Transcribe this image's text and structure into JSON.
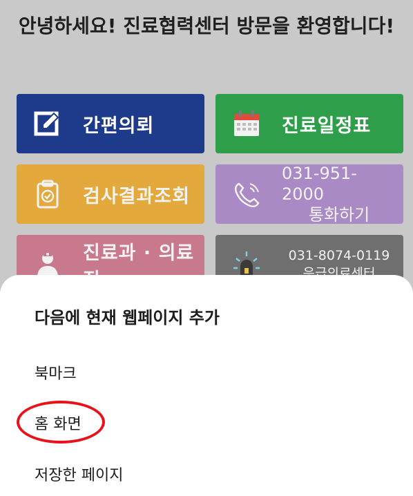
{
  "header": {
    "welcome_text": "안녕하세요! 진료협력센터 방문을 환영합니다!"
  },
  "tiles": [
    {
      "label": "간편의뢰",
      "icon": "edit-icon"
    },
    {
      "label": "진료일정표",
      "icon": "calendar-icon"
    },
    {
      "label": "검사결과조회",
      "icon": "clipboard-icon"
    },
    {
      "line1": "031-951-2000",
      "line2": "통화하기",
      "icon": "phone-icon"
    },
    {
      "label": "진료과 · 의료진",
      "icon": "doctor-icon"
    },
    {
      "line1": "031-8074-0119",
      "line2": "응급의료센터",
      "icon": "siren-icon"
    }
  ],
  "sheet": {
    "title": "다음에 현재 웹페이지 추가",
    "options": [
      "북마크",
      "홈 화면",
      "저장한 페이지"
    ]
  },
  "colors": {
    "highlight": "#e8121a",
    "tile_blue": "#1e3a8a",
    "tile_green": "#2f9e4a",
    "tile_yellow": "#e3a93c",
    "tile_purple": "#a98ac4",
    "tile_pink": "#c9798e",
    "tile_gray": "#6f6f6f"
  }
}
